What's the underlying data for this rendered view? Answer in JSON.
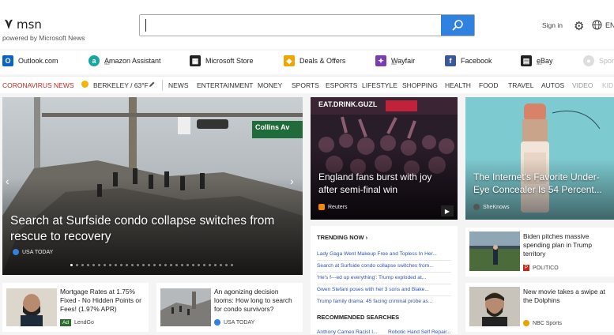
{
  "header": {
    "logo": "msn",
    "powered_by": "powered by Microsoft News",
    "search_value": "",
    "signin": "Sign in",
    "lang": "EN"
  },
  "quicklinks": [
    {
      "label": "Outlook.com",
      "icon": "outlook-icon",
      "color": "#0a64c8",
      "ad": ""
    },
    {
      "label": "Amazon Assistant",
      "icon": "amazon-icon",
      "color": "#16a89c",
      "ad": "ad"
    },
    {
      "label": "Microsoft Store",
      "icon": "store-icon",
      "color": "#222222",
      "ad": ""
    },
    {
      "label": "Deals & Offers",
      "icon": "tag-icon",
      "color": "#f0a500",
      "ad": ""
    },
    {
      "label": "Wayfair",
      "icon": "wayfair-icon",
      "color": "#7a3fae",
      "ad": "ad"
    },
    {
      "label": "Facebook",
      "icon": "facebook-icon",
      "color": "#3b5998",
      "ad": ""
    },
    {
      "label": "eBay",
      "icon": "shopping-bag-icon",
      "color": "#222222",
      "ad": "ad"
    },
    {
      "label": "Spor",
      "icon": "sports-icon",
      "color": "#cccccc",
      "ad": ""
    }
  ],
  "nav": {
    "corona": "CORONAVIRUS NEWS",
    "weather": "BERKELEY / 63°F",
    "items": [
      "NEWS",
      "ENTERTAINMENT",
      "MONEY",
      "SPORTS",
      "ESPORTS",
      "LIFESTYLE",
      "SHOPPING",
      "HEALTH",
      "FOOD",
      "TRAVEL",
      "AUTOS",
      "VIDEO",
      "KID"
    ]
  },
  "hero": {
    "sign": "Collins Av",
    "title": "Search at Surfside condo collapse switches from rescue to recovery",
    "source": "USA TODAY"
  },
  "tiles": {
    "england": {
      "banner": "EAT.DRINK.GUZL",
      "title": "England fans burst with joy after semi-final win",
      "source": "Reuters"
    },
    "concealer": {
      "title": "The Internet's Favorite Under-Eye Concealer Is 54 Percent...",
      "source": "SheKnows"
    }
  },
  "cards": {
    "mortgage": {
      "title": "Mortgage Rates at 1.75% Fixed - No Hidden Points or Fees! (1.97% APR)",
      "badge": "Ad",
      "source": "LendGo"
    },
    "condo": {
      "title": "An agonizing decision looms: How long to search for condo survivors?",
      "source": "USA TODAY"
    },
    "biden": {
      "title": "Biden pitches massive spending plan in Trump territory",
      "source": "POLITICO"
    },
    "movie": {
      "title": "New movie takes a swipe at the Dolphins",
      "source": "NBC Sports"
    }
  },
  "trending": {
    "heading": "TRENDING NOW",
    "items": [
      "Lady Gaga Went Makeup Free and Topless In Her...",
      "Search at Surfside condo collapse switches from...",
      "'He's f---ed up everything': Trump exploded at...",
      "Gwen Stefani poses with her 3 sons and Blake...",
      "Trump family drama: 45 facing criminal probe as..."
    ],
    "recommended": "RECOMMENDED SEARCHES",
    "rec_items": [
      "Anthony Cameo Racist I...",
      "Robotic Hand Self Repair..."
    ]
  },
  "colors": {
    "accent": "#2f82e0",
    "red": "#c5281c",
    "link": "#2a56b8"
  }
}
